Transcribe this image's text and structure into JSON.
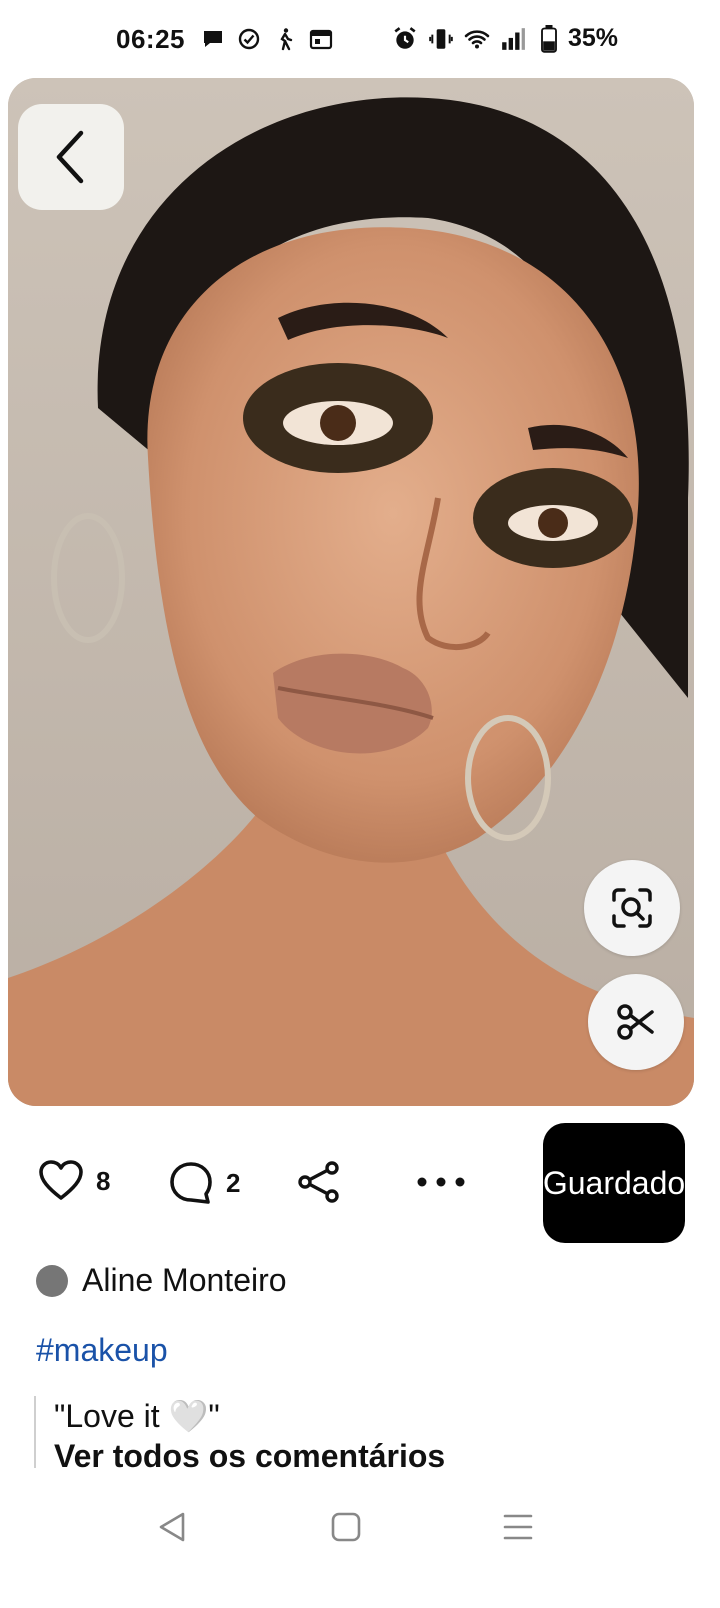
{
  "status_bar": {
    "time": "06:25",
    "battery_percent": "35%",
    "left_icons": [
      "chat-bubble-icon",
      "check-circle-icon",
      "walking-icon",
      "calendar-icon"
    ],
    "right_icons": [
      "alarm-icon",
      "vibrate-icon",
      "wifi-icon",
      "signal-icon",
      "battery-icon"
    ]
  },
  "pin": {
    "image_icons": [
      "visual-search-icon",
      "scissors-icon"
    ]
  },
  "actions": {
    "likes_count": "8",
    "comments_count": "2",
    "save_label": "Guardado"
  },
  "author": {
    "name": "Aline Monteiro",
    "avatar_color": "#767676"
  },
  "description": {
    "hashtag": "#makeup"
  },
  "comments": {
    "preview": "\"Love it 🤍\"",
    "see_all_label": "Ver todos os comentários"
  },
  "colors": {
    "save_bg": "#000000",
    "hashtag": "#1a52a8"
  }
}
